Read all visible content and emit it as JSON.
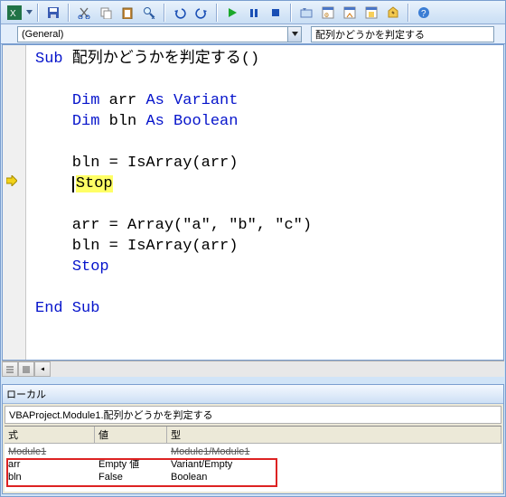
{
  "dropdowns": {
    "object": "(General)",
    "procedure": "配列かどうかを判定する"
  },
  "code": {
    "l1a": "Sub",
    "l1b": " 配列かどうかを判定する()",
    "l3": "Dim",
    "l3b": " arr ",
    "l3c": "As Variant",
    "l4": "Dim",
    "l4b": " bln ",
    "l4c": "As Boolean",
    "l6": "    bln = IsArray(arr)",
    "l7": "Stop",
    "l9": "    arr = Array(\"a\", \"b\", \"c\")",
    "l10": "    bln = IsArray(arr)",
    "l11": "Stop",
    "l13": "End Sub"
  },
  "locals": {
    "title": "ローカル",
    "context": "VBAProject.Module1.配列かどうかを判定する",
    "headers": {
      "expr": "式",
      "val": "値",
      "type": "型"
    },
    "rows": [
      {
        "expr": "Module1",
        "val": "",
        "type": "Module1/Module1",
        "strike": true
      },
      {
        "expr": "arr",
        "val": "Empty 値",
        "type": "Variant/Empty"
      },
      {
        "expr": "bln",
        "val": "False",
        "type": "Boolean"
      }
    ]
  }
}
